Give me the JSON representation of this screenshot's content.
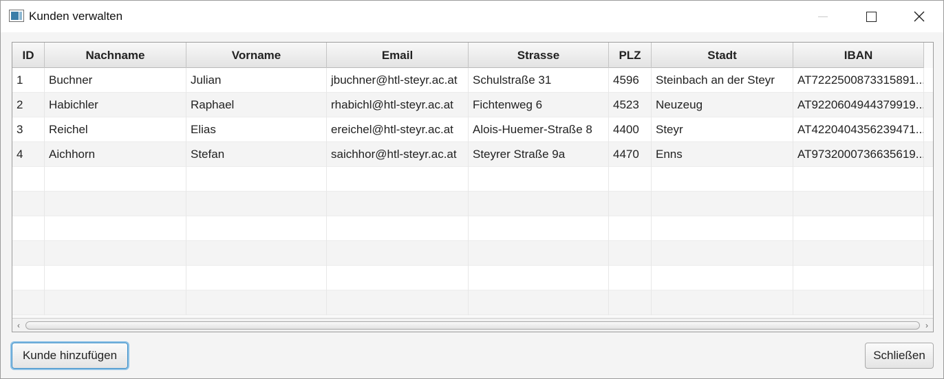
{
  "window": {
    "title": "Kunden verwalten",
    "icons": {
      "app": "app-window-icon",
      "minimize": "minimize-icon",
      "maximize": "maximize-icon",
      "close": "close-icon"
    }
  },
  "table": {
    "columns": [
      "ID",
      "Nachname",
      "Vorname",
      "Email",
      "Strasse",
      "PLZ",
      "Stadt",
      "IBAN"
    ],
    "rows": [
      [
        "1",
        "Buchner",
        "Julian",
        "jbuchner@htl-steyr.ac.at",
        "Schulstraße 31",
        "4596",
        "Steinbach an der Steyr",
        "AT7222500873315891..."
      ],
      [
        "2",
        "Habichler",
        "Raphael",
        "rhabichl@htl-steyr.ac.at",
        "Fichtenweg 6",
        "4523",
        "Neuzeug",
        "AT9220604944379919..."
      ],
      [
        "3",
        "Reichel",
        "Elias",
        "ereichel@htl-steyr.ac.at",
        "Alois-Huemer-Straße 8",
        "4400",
        "Steyr",
        "AT4220404356239471..."
      ],
      [
        "4",
        "Aichhorn",
        "Stefan",
        "saichhor@htl-steyr.ac.at",
        "Steyrer Straße 9a",
        "4470",
        "Enns",
        "AT9732000736635619..."
      ]
    ],
    "empty_rows": 6
  },
  "buttons": {
    "add_label": "Kunde hinzufügen",
    "close_label": "Schließen"
  },
  "colors": {
    "focus_ring": "#8ec2e6",
    "header_bg": "#e3e3e3"
  }
}
